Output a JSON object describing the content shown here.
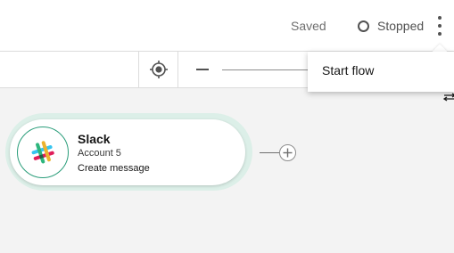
{
  "header": {
    "saved_label": "Saved",
    "status_label": "Stopped",
    "status_icon": "circle-outline-icon",
    "menu_icon": "overflow-menu-vertical-icon"
  },
  "toolbar": {
    "locate_icon": "locate-icon",
    "zoom_out_icon": "minus-icon"
  },
  "menu": {
    "items": [
      {
        "label": "Start flow"
      }
    ]
  },
  "flow": {
    "nodes": [
      {
        "app": "Slack",
        "account": "Account 5",
        "action": "Create message",
        "icon": "slack-logo-icon"
      }
    ],
    "add_icon": "plus-icon"
  },
  "colors": {
    "node_ring": "#dcefe8",
    "node_logo_border": "#2a9d7a",
    "canvas": "#f3f3f3"
  }
}
